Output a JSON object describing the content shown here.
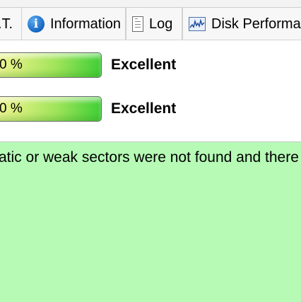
{
  "tabs": [
    {
      "label": ".T.",
      "icon": "none"
    },
    {
      "label": "Information",
      "icon": "info-icon"
    },
    {
      "label": "Log",
      "icon": "document-icon"
    },
    {
      "label": "Disk Performance",
      "icon": "performance-chart-icon"
    }
  ],
  "health_rows": [
    {
      "bar_text": "0 %",
      "fill_fraction": 1.0,
      "status": "Excellent"
    },
    {
      "bar_text": "0 %",
      "fill_fraction": 1.0,
      "status": "Excellent"
    }
  ],
  "message": {
    "text": "atic or weak sectors were not found and there are no"
  },
  "colors": {
    "bar_fill_start": "#f3f59a",
    "bar_fill_end": "#3fcf36",
    "panel_background": "#b6fab6",
    "info_icon": "#1566c2"
  }
}
